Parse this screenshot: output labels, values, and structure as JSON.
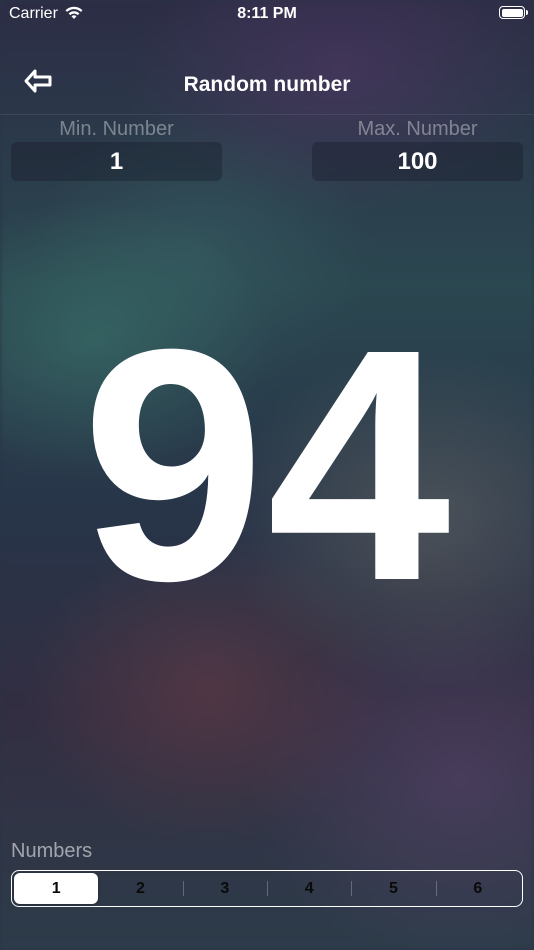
{
  "status_bar": {
    "carrier": "Carrier",
    "time": "8:11 PM",
    "icons": [
      "wifi-icon",
      "battery-icon"
    ]
  },
  "nav": {
    "title": "Random number",
    "back_icon": "back-arrow-icon"
  },
  "range": {
    "min_label": "Min. Number",
    "min_value": "1",
    "max_label": "Max. Number",
    "max_value": "100"
  },
  "result": "94",
  "numbers": {
    "label": "Numbers",
    "segments": [
      "1",
      "2",
      "3",
      "4",
      "5",
      "6"
    ],
    "selected": "1"
  },
  "colors": {
    "text": "#ffffff",
    "segment_selected_bg": "#ffffff",
    "segment_text": "#0a0a0a"
  }
}
